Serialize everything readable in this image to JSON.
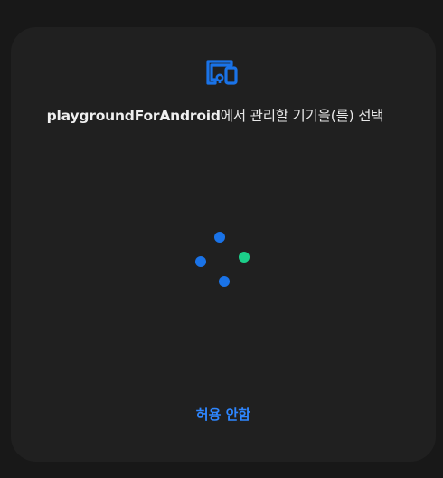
{
  "dialog": {
    "header_icon": "device-manage-icon",
    "title_app": "playgroundForAndroid",
    "title_rest": "에서 관리할 기기을(를) 선택",
    "progress_icon": "loading-dots-icon",
    "deny_button_label": "허용 안함"
  },
  "colors": {
    "accent": "#1a73e8",
    "accent_alt": "#1ccf8a",
    "dialog_bg": "#202020",
    "page_bg": "#181818"
  }
}
